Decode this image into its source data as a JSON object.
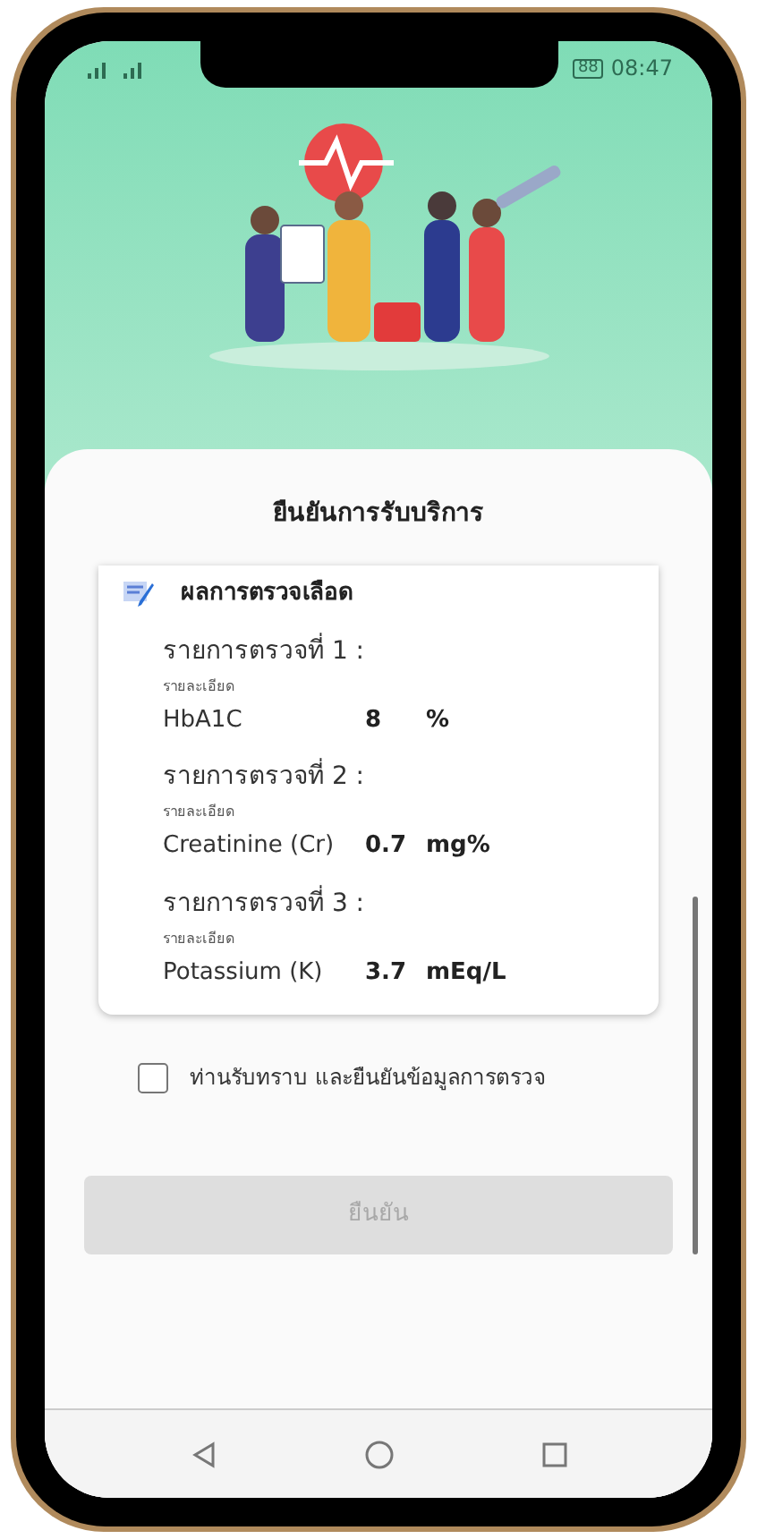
{
  "status_bar": {
    "battery": "88",
    "time": "08:47"
  },
  "title": "ยืนยันการรับบริการ",
  "card": {
    "heading": "ผลการตรวจเลือด",
    "tests": [
      {
        "label": "รายการตรวจที่ 1 :",
        "detail_label": "รายละเอียด",
        "name": "HbA1C",
        "value": "8",
        "unit": "%"
      },
      {
        "label": "รายการตรวจที่ 2 :",
        "detail_label": "รายละเอียด",
        "name": "Creatinine (Cr)",
        "value": "0.7",
        "unit": "mg%"
      },
      {
        "label": "รายการตรวจที่ 3 :",
        "detail_label": "รายละเอียด",
        "name": "Potassium (K)",
        "value": "3.7",
        "unit": "mEq/L"
      }
    ]
  },
  "consent": {
    "label": "ท่านรับทราบ และยืนยันข้อมูลการตรวจ",
    "checked": false
  },
  "confirm_button": {
    "label": "ยืนยัน",
    "disabled": true
  }
}
